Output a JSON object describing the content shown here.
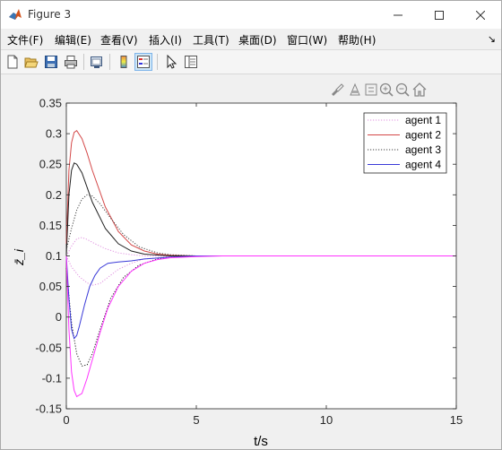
{
  "window": {
    "title": "Figure 3",
    "buttons": {
      "minimize": "—",
      "maximize": "☐",
      "close": "✕"
    }
  },
  "menu": {
    "items": [
      {
        "label": "文件(F)"
      },
      {
        "label": "编辑(E)"
      },
      {
        "label": "查看(V)"
      },
      {
        "label": "插入(I)"
      },
      {
        "label": "工具(T)"
      },
      {
        "label": "桌面(D)"
      },
      {
        "label": "窗口(W)"
      },
      {
        "label": "帮助(H)"
      }
    ],
    "dock_arrow": "↘"
  },
  "toolbar": {
    "icons": [
      "new-figure-icon",
      "open-file-icon",
      "save-icon",
      "print-icon",
      "link-plot-icon",
      "colorbar-icon",
      "legend-icon",
      "edit-plot-icon",
      "property-inspector-icon"
    ],
    "active": [
      "legend-icon"
    ]
  },
  "axes_toolbar": {
    "icons": [
      "brush-icon",
      "data-tips-icon",
      "rotate-icon",
      "zoom-in-icon",
      "zoom-out-icon",
      "home-icon"
    ]
  },
  "colors": {
    "agent1": "#e090e0",
    "agent2": "#d44848",
    "agent3": "#404040",
    "agent4": "#3a3ad8",
    "magenta": "#ff33ff",
    "dark": "#202020"
  },
  "chart_data": {
    "type": "line",
    "xlabel": "t/s",
    "ylabel": "z̄_i",
    "xlim": [
      0,
      15
    ],
    "ylim": [
      -0.15,
      0.35
    ],
    "xticks": [
      "0",
      "5",
      "10",
      "15"
    ],
    "yticks": [
      "-0.15",
      "-0.1",
      "-0.05",
      "0",
      "0.05",
      "0.1",
      "0.15",
      "0.2",
      "0.25",
      "0.3",
      "0.35"
    ],
    "grid": false,
    "legend_position": "top-right",
    "legend": [
      "agent 1",
      "agent 2",
      "agent 3",
      "agent 4"
    ],
    "series": [
      {
        "name": "agent 1",
        "style": "dotted",
        "color": "#e090e0",
        "x": [
          0,
          0.2,
          0.5,
          0.8,
          1.0,
          1.3,
          1.6,
          2.0,
          2.5,
          3,
          4,
          5,
          6,
          8,
          10,
          15
        ],
        "y": [
          0.1,
          0.082,
          0.066,
          0.056,
          0.052,
          0.055,
          0.065,
          0.078,
          0.088,
          0.095,
          0.099,
          0.1,
          0.1,
          0.1,
          0.1,
          0.1
        ]
      },
      {
        "name": "agent 1",
        "style": "dotted",
        "color": "#e090e0",
        "x": [
          0,
          0.2,
          0.4,
          0.6,
          0.8,
          1.1,
          1.5,
          2.0,
          2.5,
          3,
          4,
          5,
          6,
          8,
          10,
          15
        ],
        "y": [
          0.1,
          0.116,
          0.128,
          0.13,
          0.127,
          0.12,
          0.112,
          0.105,
          0.102,
          0.1,
          0.1,
          0.1,
          0.1,
          0.1,
          0.1,
          0.1
        ]
      },
      {
        "name": "agent 2",
        "style": "solid",
        "color": "#d44848",
        "x": [
          0,
          0.1,
          0.2,
          0.3,
          0.4,
          0.6,
          0.8,
          1.0,
          1.5,
          2.0,
          2.5,
          3.0,
          3.5,
          4,
          5,
          6,
          8,
          10,
          15
        ],
        "y": [
          0.12,
          0.24,
          0.285,
          0.302,
          0.305,
          0.292,
          0.268,
          0.24,
          0.18,
          0.14,
          0.118,
          0.108,
          0.103,
          0.101,
          0.1,
          0.1,
          0.1,
          0.1,
          0.1
        ]
      },
      {
        "name": "agent 2",
        "style": "solid",
        "color": "#202020",
        "x": [
          0,
          0.1,
          0.2,
          0.3,
          0.4,
          0.6,
          0.8,
          1.0,
          1.5,
          2.0,
          2.5,
          3.0,
          4,
          5,
          6,
          8,
          10,
          15
        ],
        "y": [
          0.1,
          0.2,
          0.24,
          0.252,
          0.25,
          0.236,
          0.212,
          0.188,
          0.145,
          0.12,
          0.108,
          0.103,
          0.1,
          0.1,
          0.1,
          0.1,
          0.1,
          0.1
        ]
      },
      {
        "name": "agent 3",
        "style": "dotted",
        "color": "#404040",
        "x": [
          0,
          0.2,
          0.4,
          0.6,
          0.8,
          1.0,
          1.3,
          1.7,
          2.2,
          2.8,
          3.5,
          4,
          5,
          6,
          8,
          10,
          15
        ],
        "y": [
          0.11,
          0.145,
          0.175,
          0.193,
          0.2,
          0.198,
          0.185,
          0.162,
          0.135,
          0.115,
          0.105,
          0.102,
          0.1,
          0.1,
          0.1,
          0.1,
          0.1
        ]
      },
      {
        "name": "agent 3",
        "style": "dotted",
        "color": "#202020",
        "x": [
          0,
          0.2,
          0.4,
          0.6,
          0.8,
          1.0,
          1.3,
          1.7,
          2.2,
          2.8,
          3.5,
          4,
          5,
          6,
          8,
          10,
          15
        ],
        "y": [
          0.08,
          -0.01,
          -0.06,
          -0.08,
          -0.078,
          -0.06,
          -0.02,
          0.03,
          0.065,
          0.085,
          0.095,
          0.098,
          0.1,
          0.1,
          0.1,
          0.1,
          0.1
        ]
      },
      {
        "name": "agent 4",
        "style": "solid",
        "color": "#3a3ad8",
        "x": [
          0,
          0.1,
          0.2,
          0.3,
          0.4,
          0.5,
          0.7,
          0.9,
          1.1,
          1.3,
          1.6,
          2.0,
          2.5,
          3,
          4,
          5,
          6,
          8,
          10,
          15
        ],
        "y": [
          0.1,
          0.03,
          -0.02,
          -0.035,
          -0.03,
          -0.015,
          0.02,
          0.05,
          0.068,
          0.08,
          0.088,
          0.09,
          0.092,
          0.095,
          0.098,
          0.1,
          0.1,
          0.1,
          0.1,
          0.1
        ]
      },
      {
        "name": "agent 4",
        "style": "solid",
        "color": "#ff33ff",
        "x": [
          0,
          0.1,
          0.2,
          0.3,
          0.4,
          0.6,
          0.8,
          1.0,
          1.3,
          1.6,
          2.0,
          2.5,
          3,
          3.5,
          4,
          5,
          6,
          8,
          10,
          15
        ],
        "y": [
          0.1,
          -0.02,
          -0.09,
          -0.12,
          -0.13,
          -0.125,
          -0.1,
          -0.07,
          -0.025,
          0.015,
          0.05,
          0.075,
          0.088,
          0.094,
          0.097,
          0.099,
          0.1,
          0.1,
          0.1,
          0.1
        ]
      }
    ]
  }
}
